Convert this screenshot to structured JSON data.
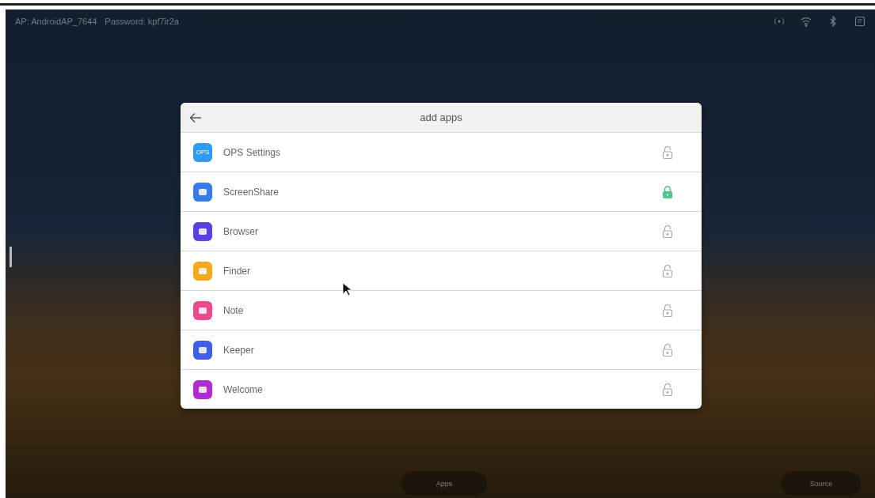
{
  "status_bar": {
    "hotspot": "AP: AndroidAP_7644",
    "password": "Password: kpf7ir2a"
  },
  "dialog": {
    "title": "add apps",
    "apps": [
      {
        "name": "OPS Settings",
        "color": "#2f9bf2",
        "badge": "OPS",
        "locked": false
      },
      {
        "name": "ScreenShare",
        "color": "#3a7bea",
        "locked": true
      },
      {
        "name": "Browser",
        "color": "#5b3fe0",
        "locked": false
      },
      {
        "name": "Finder",
        "color": "#f2a91f",
        "locked": false
      },
      {
        "name": "Note",
        "color": "#ec4a8c",
        "locked": false
      },
      {
        "name": "Keeper",
        "color": "#3f5de8",
        "locked": false
      },
      {
        "name": "Welcome",
        "color": "#b02bd0",
        "locked": false
      }
    ]
  },
  "dock": [
    {
      "label": "Apps"
    },
    {
      "label": "Source"
    }
  ]
}
